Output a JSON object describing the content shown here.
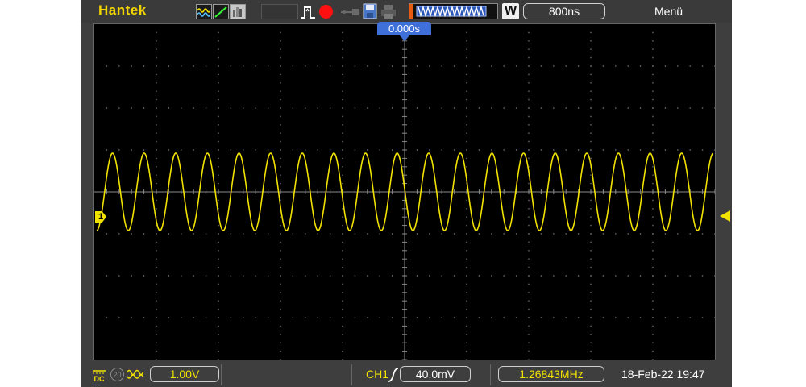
{
  "header": {
    "brand": "Hantek",
    "timebase": "800ns",
    "timebase_mode": "W",
    "menu_label": "Menü"
  },
  "screen": {
    "trigger_position": "0.000s",
    "channel_marker": "1",
    "signal": {
      "type": "sine",
      "color": "#f2e200",
      "frequency": "1.26843MHz",
      "cycles_visible": 19.5
    }
  },
  "footer": {
    "coupling": "DC",
    "bandwidth_limit": "20",
    "volts_per_div": "1.00V",
    "trigger_source": "CH1",
    "trigger_edge": "rising",
    "trigger_level": "40.0mV",
    "frequency_readout": "1.26843MHz",
    "datetime": "18-Feb-22 19:47"
  },
  "colors": {
    "brand": "#f4d400",
    "channel1": "#f2e200",
    "trigger_marker": "#3f6fd8",
    "record_dot": "#ff1010",
    "memory_marker": "#e85c12"
  },
  "icons": {
    "modes": [
      "sine-wave-icon",
      "ramp-icon",
      "persistence-icon"
    ],
    "toolbar": [
      "pulse-icon",
      "record-icon",
      "usb-icon",
      "save-icon",
      "print-icon"
    ]
  }
}
